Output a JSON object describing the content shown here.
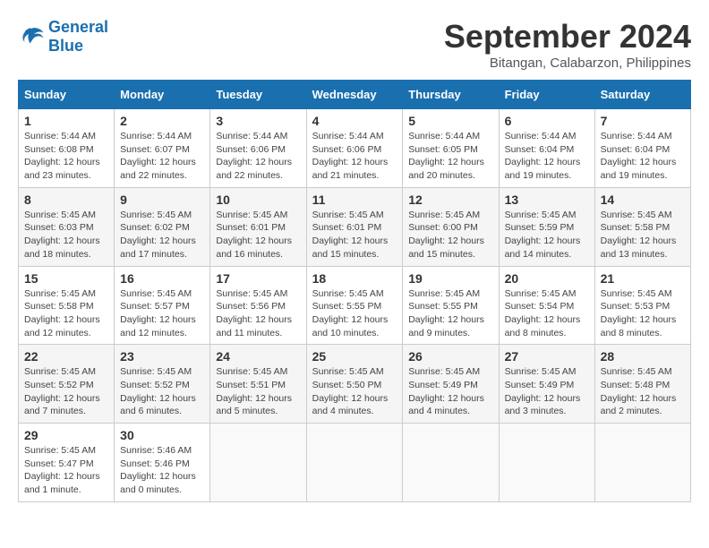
{
  "header": {
    "logo_line1": "General",
    "logo_line2": "Blue",
    "month_title": "September 2024",
    "location": "Bitangan, Calabarzon, Philippines"
  },
  "weekdays": [
    "Sunday",
    "Monday",
    "Tuesday",
    "Wednesday",
    "Thursday",
    "Friday",
    "Saturday"
  ],
  "weeks": [
    [
      {
        "day": "1",
        "sunrise": "5:44 AM",
        "sunset": "6:08 PM",
        "daylight": "12 hours and 23 minutes."
      },
      {
        "day": "2",
        "sunrise": "5:44 AM",
        "sunset": "6:07 PM",
        "daylight": "12 hours and 22 minutes."
      },
      {
        "day": "3",
        "sunrise": "5:44 AM",
        "sunset": "6:06 PM",
        "daylight": "12 hours and 22 minutes."
      },
      {
        "day": "4",
        "sunrise": "5:44 AM",
        "sunset": "6:06 PM",
        "daylight": "12 hours and 21 minutes."
      },
      {
        "day": "5",
        "sunrise": "5:44 AM",
        "sunset": "6:05 PM",
        "daylight": "12 hours and 20 minutes."
      },
      {
        "day": "6",
        "sunrise": "5:44 AM",
        "sunset": "6:04 PM",
        "daylight": "12 hours and 19 minutes."
      },
      {
        "day": "7",
        "sunrise": "5:44 AM",
        "sunset": "6:04 PM",
        "daylight": "12 hours and 19 minutes."
      }
    ],
    [
      {
        "day": "8",
        "sunrise": "5:45 AM",
        "sunset": "6:03 PM",
        "daylight": "12 hours and 18 minutes."
      },
      {
        "day": "9",
        "sunrise": "5:45 AM",
        "sunset": "6:02 PM",
        "daylight": "12 hours and 17 minutes."
      },
      {
        "day": "10",
        "sunrise": "5:45 AM",
        "sunset": "6:01 PM",
        "daylight": "12 hours and 16 minutes."
      },
      {
        "day": "11",
        "sunrise": "5:45 AM",
        "sunset": "6:01 PM",
        "daylight": "12 hours and 15 minutes."
      },
      {
        "day": "12",
        "sunrise": "5:45 AM",
        "sunset": "6:00 PM",
        "daylight": "12 hours and 15 minutes."
      },
      {
        "day": "13",
        "sunrise": "5:45 AM",
        "sunset": "5:59 PM",
        "daylight": "12 hours and 14 minutes."
      },
      {
        "day": "14",
        "sunrise": "5:45 AM",
        "sunset": "5:58 PM",
        "daylight": "12 hours and 13 minutes."
      }
    ],
    [
      {
        "day": "15",
        "sunrise": "5:45 AM",
        "sunset": "5:58 PM",
        "daylight": "12 hours and 12 minutes."
      },
      {
        "day": "16",
        "sunrise": "5:45 AM",
        "sunset": "5:57 PM",
        "daylight": "12 hours and 12 minutes."
      },
      {
        "day": "17",
        "sunrise": "5:45 AM",
        "sunset": "5:56 PM",
        "daylight": "12 hours and 11 minutes."
      },
      {
        "day": "18",
        "sunrise": "5:45 AM",
        "sunset": "5:55 PM",
        "daylight": "12 hours and 10 minutes."
      },
      {
        "day": "19",
        "sunrise": "5:45 AM",
        "sunset": "5:55 PM",
        "daylight": "12 hours and 9 minutes."
      },
      {
        "day": "20",
        "sunrise": "5:45 AM",
        "sunset": "5:54 PM",
        "daylight": "12 hours and 8 minutes."
      },
      {
        "day": "21",
        "sunrise": "5:45 AM",
        "sunset": "5:53 PM",
        "daylight": "12 hours and 8 minutes."
      }
    ],
    [
      {
        "day": "22",
        "sunrise": "5:45 AM",
        "sunset": "5:52 PM",
        "daylight": "12 hours and 7 minutes."
      },
      {
        "day": "23",
        "sunrise": "5:45 AM",
        "sunset": "5:52 PM",
        "daylight": "12 hours and 6 minutes."
      },
      {
        "day": "24",
        "sunrise": "5:45 AM",
        "sunset": "5:51 PM",
        "daylight": "12 hours and 5 minutes."
      },
      {
        "day": "25",
        "sunrise": "5:45 AM",
        "sunset": "5:50 PM",
        "daylight": "12 hours and 4 minutes."
      },
      {
        "day": "26",
        "sunrise": "5:45 AM",
        "sunset": "5:49 PM",
        "daylight": "12 hours and 4 minutes."
      },
      {
        "day": "27",
        "sunrise": "5:45 AM",
        "sunset": "5:49 PM",
        "daylight": "12 hours and 3 minutes."
      },
      {
        "day": "28",
        "sunrise": "5:45 AM",
        "sunset": "5:48 PM",
        "daylight": "12 hours and 2 minutes."
      }
    ],
    [
      {
        "day": "29",
        "sunrise": "5:45 AM",
        "sunset": "5:47 PM",
        "daylight": "12 hours and 1 minute."
      },
      {
        "day": "30",
        "sunrise": "5:46 AM",
        "sunset": "5:46 PM",
        "daylight": "12 hours and 0 minutes."
      },
      null,
      null,
      null,
      null,
      null
    ]
  ]
}
